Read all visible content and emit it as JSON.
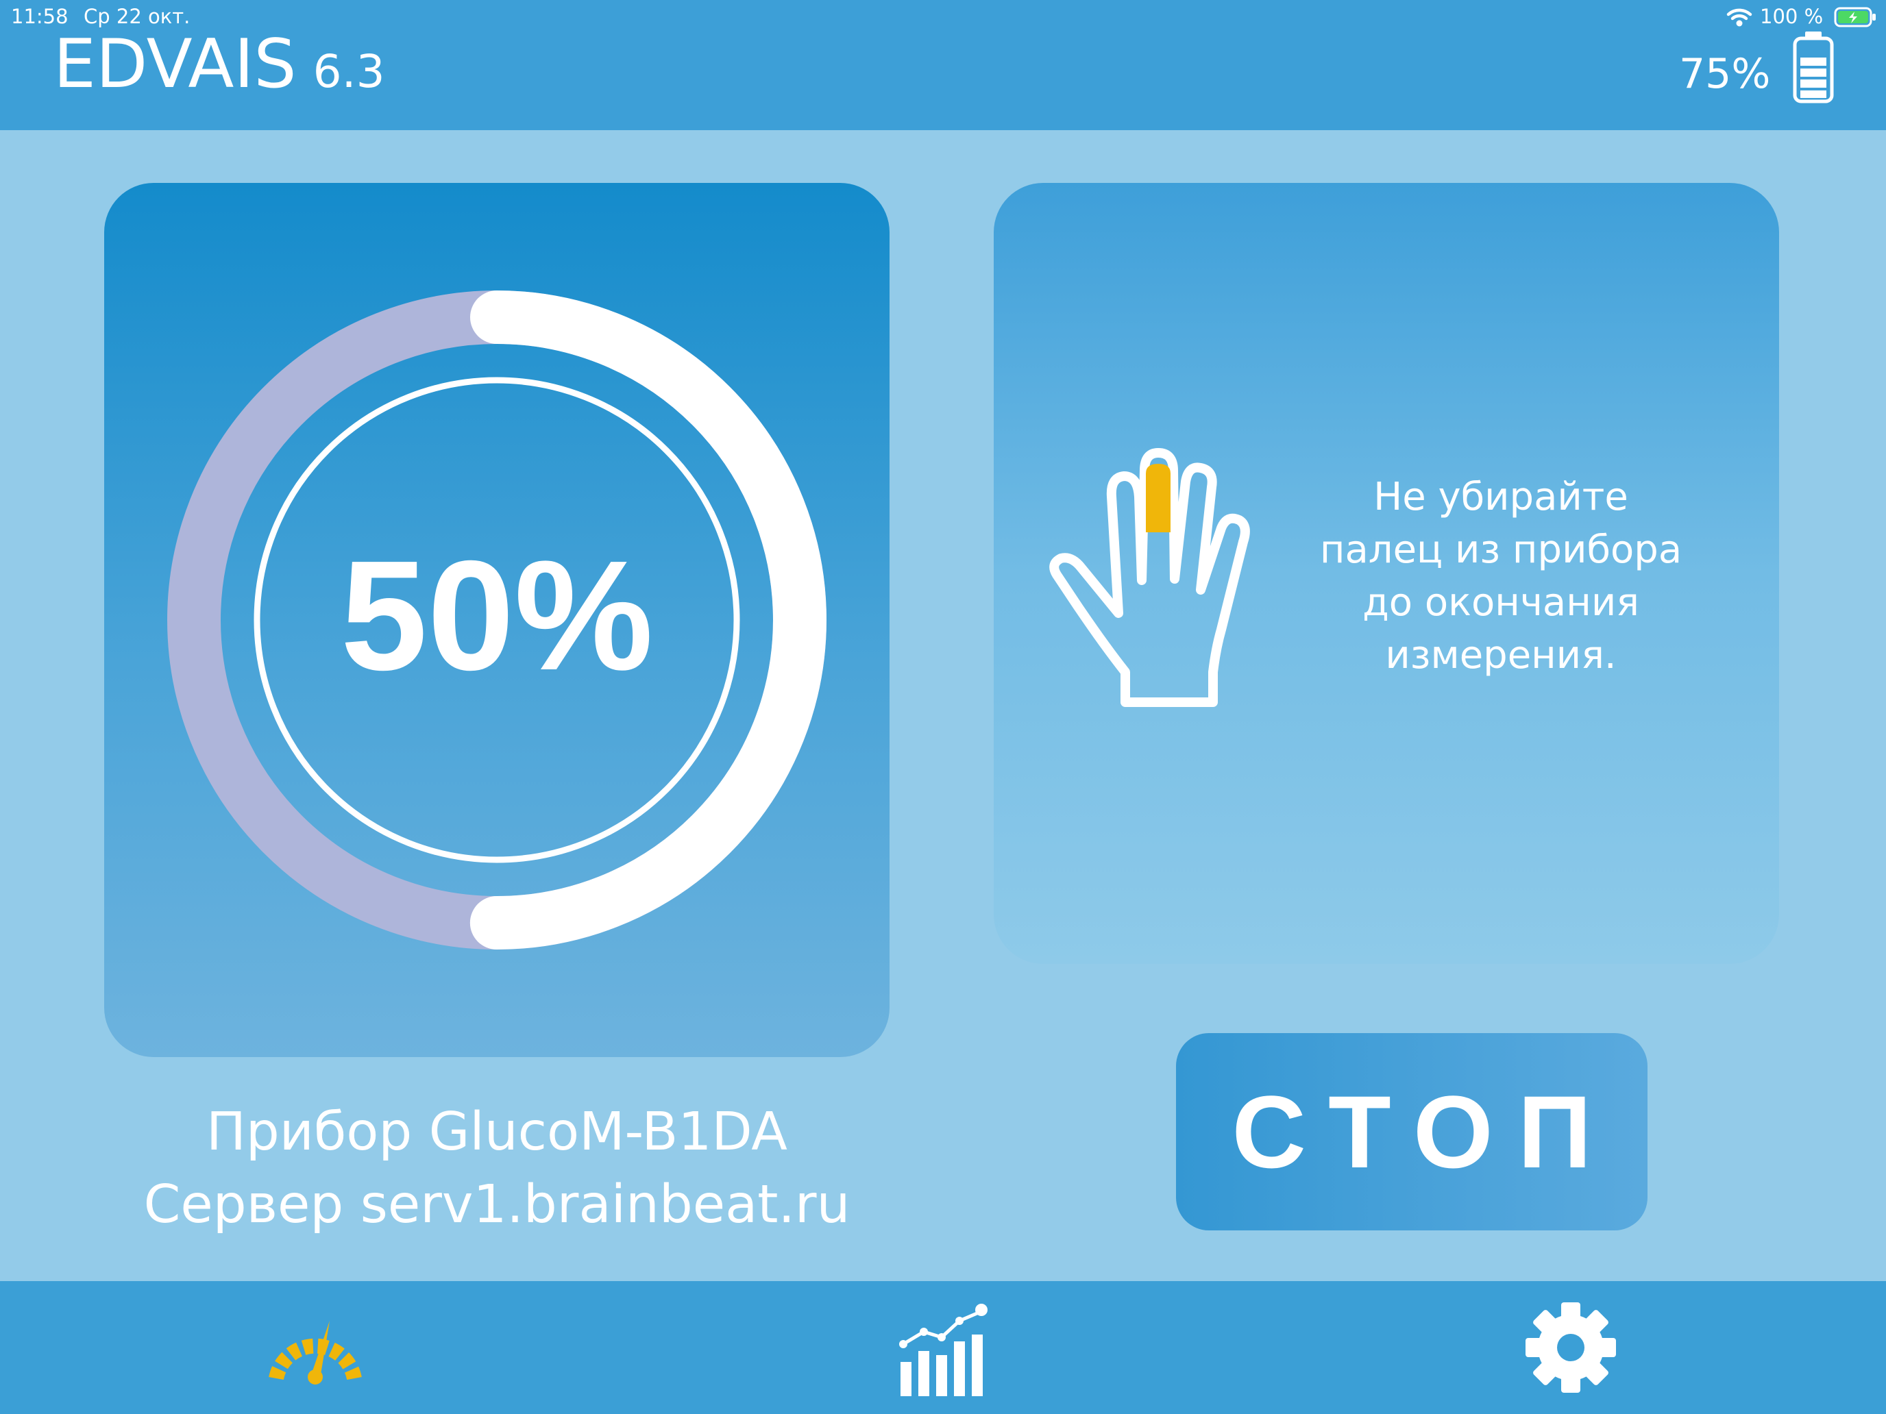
{
  "status_bar": {
    "time": "11:58",
    "date": "Ср 22 окт.",
    "battery_percent": "100 %"
  },
  "header": {
    "app_name": "EDVAIS",
    "version": "6.3",
    "device_battery": "75%"
  },
  "progress": {
    "value": 0.5,
    "label": "50%"
  },
  "instruction": {
    "line1": "Не убирайте",
    "line2": "палец из прибора",
    "line3": "до окончания",
    "line4": "измерения."
  },
  "device": {
    "device_line": "Прибор GlucoM-B1DA",
    "server_line": "Сервер serv1.brainbeat.ru"
  },
  "stop_button": {
    "label": "СТОП"
  },
  "tabbar": {
    "tabs": [
      {
        "icon": "gauge-icon",
        "active": true,
        "active_color": "#f0b60a"
      },
      {
        "icon": "chart-icon",
        "active": false
      },
      {
        "icon": "gear-icon",
        "active": false
      }
    ]
  },
  "colors": {
    "header": "#3d9fd7",
    "background": "#93cbe9",
    "ring_track": "#aeb5da",
    "ring_progress": "#ffffff",
    "finger_highlight": "#f0b60a"
  }
}
